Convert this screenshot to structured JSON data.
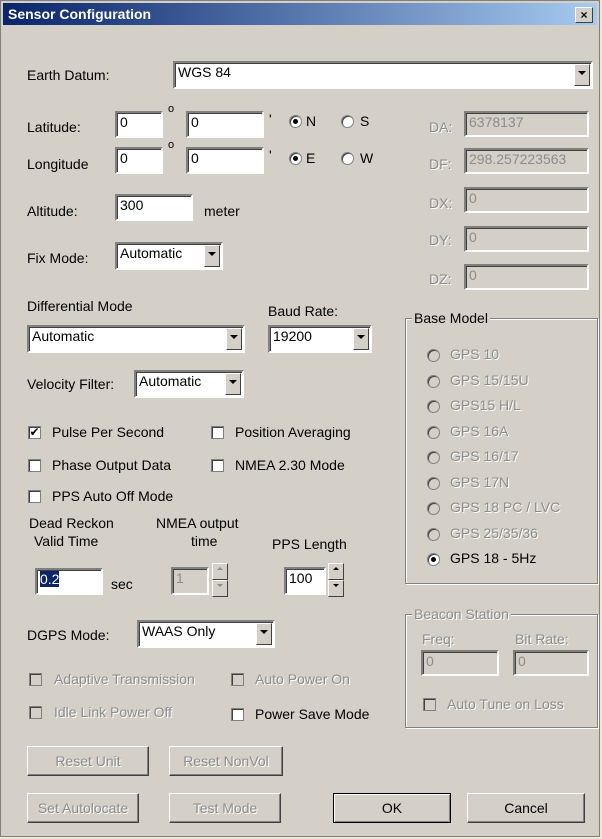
{
  "title": "Sensor Configuration",
  "close_glyph": "×",
  "earth_datum": {
    "label": "Earth Datum:",
    "value": "WGS 84"
  },
  "latitude": {
    "label": "Latitude:",
    "deg": "0",
    "min": "0",
    "deg_symbol": "o",
    "min_symbol": "'",
    "opt_n": "N",
    "opt_s": "S",
    "selected": "N"
  },
  "longitude": {
    "label": "Longitude",
    "deg": "0",
    "min": "0",
    "deg_symbol": "o",
    "min_symbol": "'",
    "opt_e": "E",
    "opt_w": "W",
    "selected": "E"
  },
  "altitude": {
    "label": "Altitude:",
    "value": "300",
    "unit": "meter"
  },
  "datum_params": [
    {
      "label": "DA:",
      "value": "6378137"
    },
    {
      "label": "DF:",
      "value": "298.257223563"
    },
    {
      "label": "DX:",
      "value": "0"
    },
    {
      "label": "DY:",
      "value": "0"
    },
    {
      "label": "DZ:",
      "value": "0"
    }
  ],
  "fix_mode": {
    "label": "Fix Mode:",
    "value": "Automatic"
  },
  "differential_mode": {
    "label": "Differential Mode",
    "value": "Automatic"
  },
  "baud_rate": {
    "label": "Baud Rate:",
    "value": "19200"
  },
  "velocity_filter": {
    "label": "Velocity Filter:",
    "value": "Automatic"
  },
  "checkboxes": {
    "pps": {
      "label": "Pulse Per Second",
      "checked": true
    },
    "position_averaging": {
      "label": "Position Averaging",
      "checked": false
    },
    "phase_output": {
      "label": "Phase Output Data",
      "checked": false
    },
    "nmea230": {
      "label": "NMEA 2.30 Mode",
      "checked": false
    },
    "pps_auto_off": {
      "label": "PPS Auto Off Mode",
      "checked": false
    }
  },
  "check_mark": "✔",
  "dead_reckon": {
    "label_line1": "Dead Reckon",
    "label_line2": "Valid Time",
    "value": "0.2",
    "unit": "sec"
  },
  "nmea_output": {
    "label_line1": "NMEA output",
    "label_line2": "time",
    "value": "1"
  },
  "pps_length": {
    "label": "PPS Length",
    "value": "100"
  },
  "base_model": {
    "title": "Base Model",
    "options": [
      "GPS 10",
      "GPS 15/15U",
      "GPS15 H/L",
      "GPS 16A",
      "GPS 16/17",
      "GPS 17N",
      "GPS 18 PC / LVC",
      "GPS 25/35/36",
      "GPS 18 - 5Hz"
    ],
    "selected": "GPS 18 - 5Hz"
  },
  "dgps_mode": {
    "label": "DGPS Mode:",
    "value": "WAAS Only"
  },
  "adaptive_transmission": {
    "label": "Adaptive Transmission"
  },
  "auto_power_on": {
    "label": "Auto Power On"
  },
  "idle_link_power_off": {
    "label": "Idle Link Power Off"
  },
  "power_save_mode": {
    "label": "Power Save Mode"
  },
  "beacon_station": {
    "title": "Beacon Station",
    "freq_label": "Freq:",
    "freq_value": "0",
    "bitrate_label": "Bit Rate:",
    "bitrate_value": "0",
    "auto_tune_label": "Auto Tune on Loss"
  },
  "buttons": {
    "reset_unit": "Reset Unit",
    "reset_nonvol": "Reset NonVol",
    "set_autolocate": "Set Autolocate",
    "test_mode": "Test Mode",
    "ok": "OK",
    "cancel": "Cancel"
  }
}
